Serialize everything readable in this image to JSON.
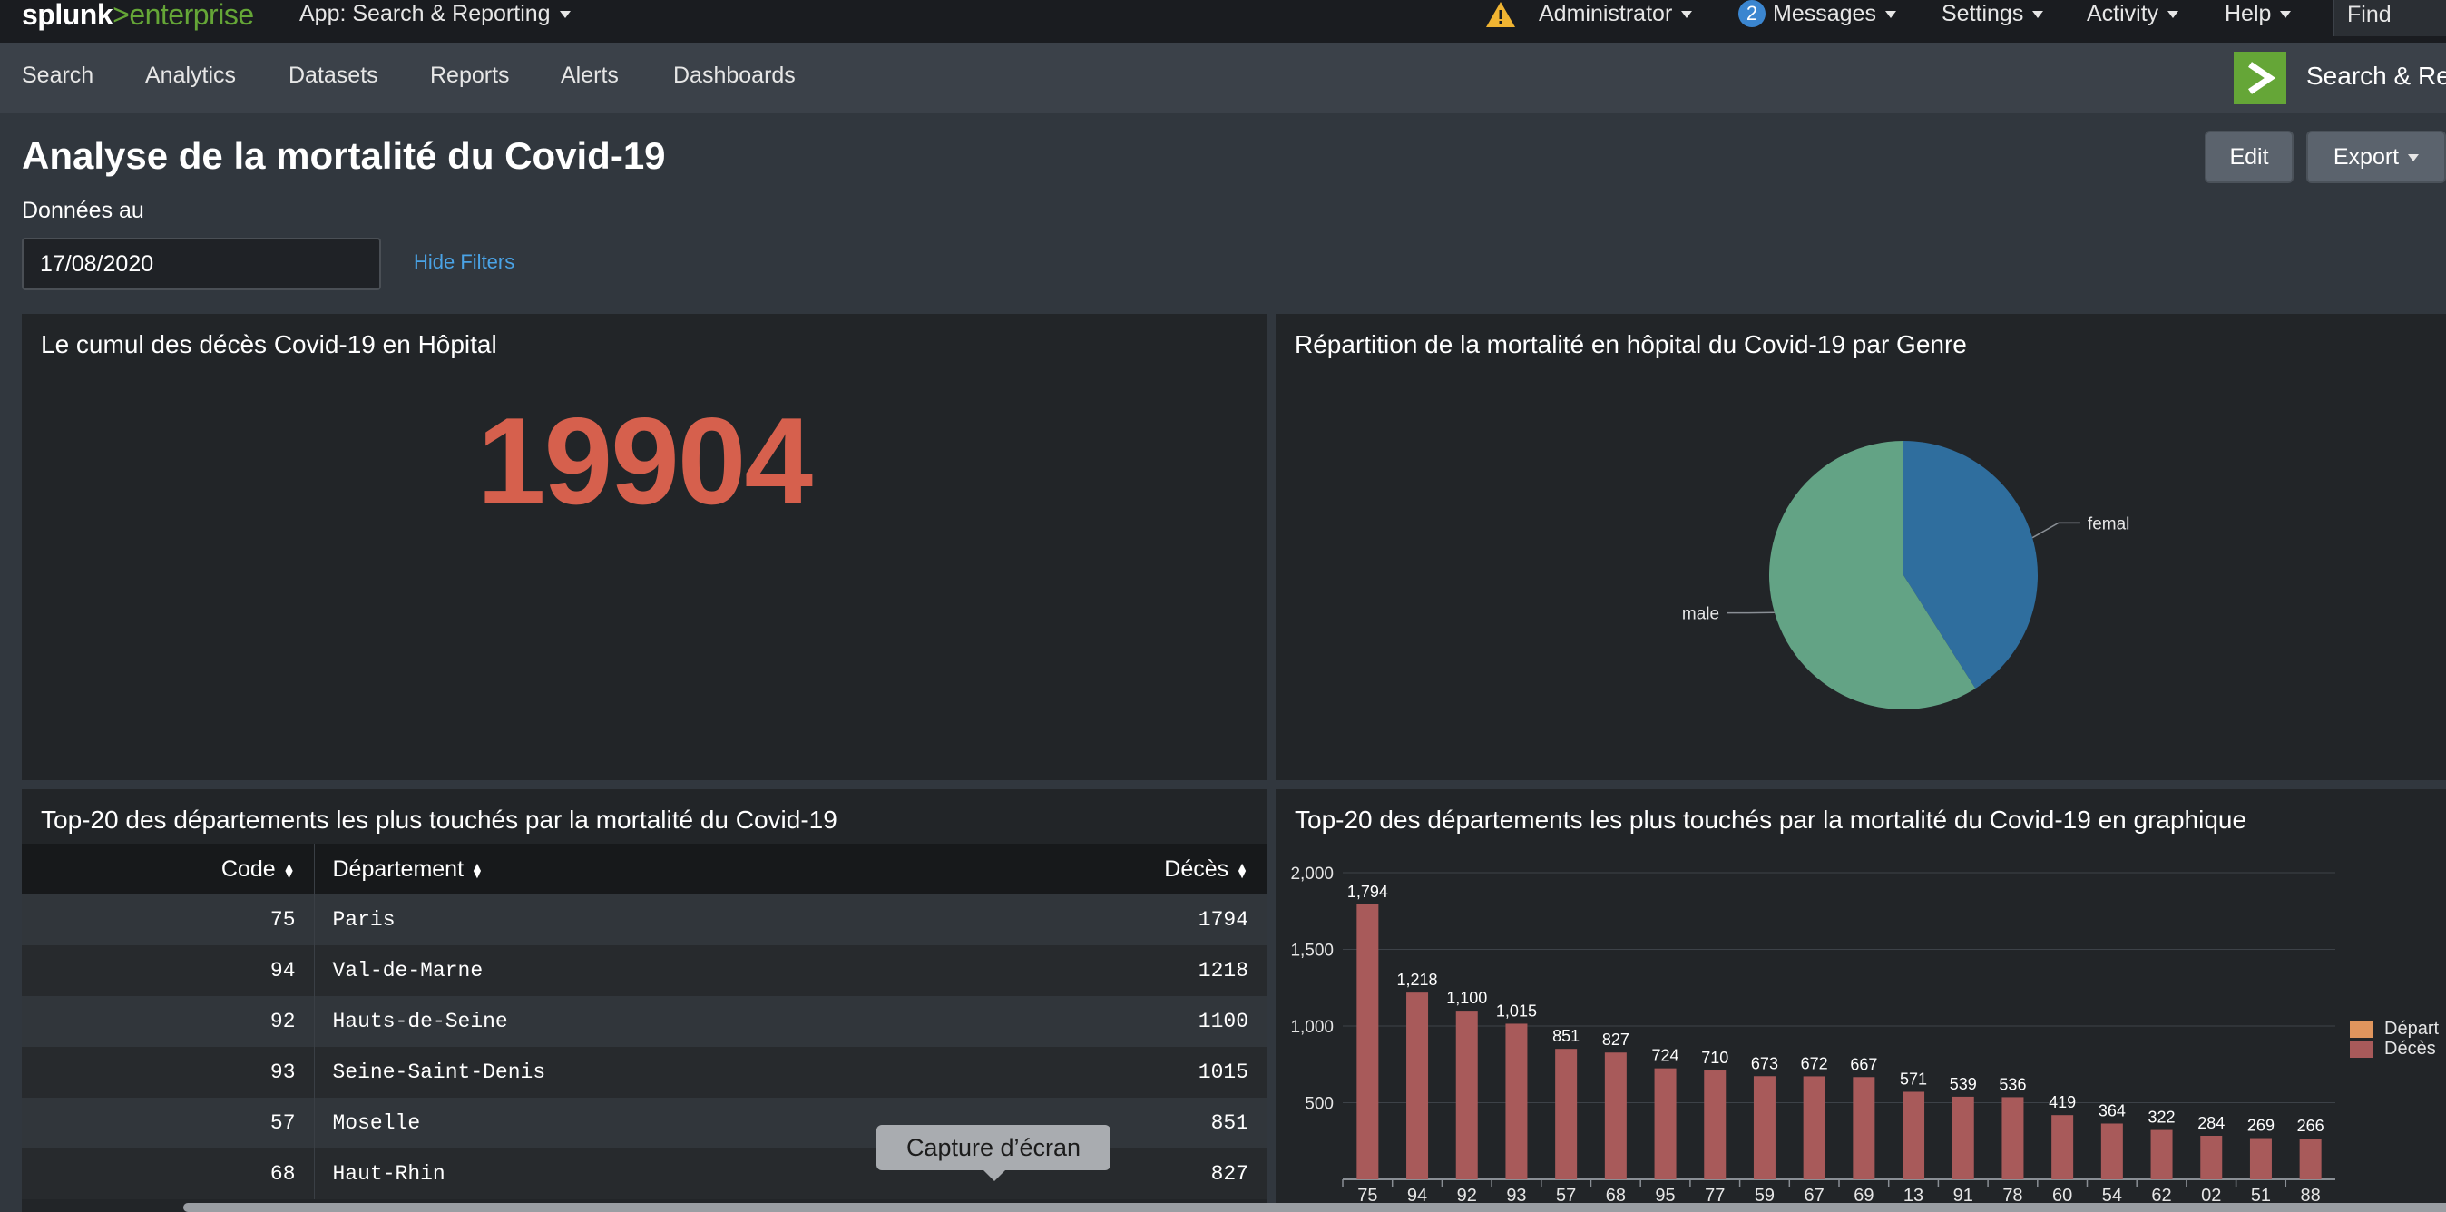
{
  "topbar": {
    "logo_main": "splunk",
    "logo_sep": ">",
    "logo_sub": "enterprise",
    "app_menu": "App: Search & Reporting",
    "user_menu": "Administrator",
    "messages_count": "2",
    "messages_label": "Messages",
    "settings": "Settings",
    "activity": "Activity",
    "help": "Help",
    "find": "Find"
  },
  "appbar": {
    "items": [
      "Search",
      "Analytics",
      "Datasets",
      "Reports",
      "Alerts",
      "Dashboards"
    ],
    "app_title": "Search & Re"
  },
  "dashboard": {
    "title": "Analyse de la mortalité du Covid-19",
    "edit": "Edit",
    "export": "Export",
    "filter_label": "Données au",
    "filter_value": "17/08/2020",
    "hide_filters": "Hide Filters"
  },
  "panels": {
    "single": {
      "title": "Le cumul des décès Covid-19 en Hôpital",
      "value": "19904"
    },
    "pie": {
      "title": "Répartition de la mortalité en hôpital du Covid-19 par Genre"
    },
    "table": {
      "title": "Top-20 des départements les plus touchés par la mortalité du Covid-19"
    },
    "bar": {
      "title": "Top-20 des départements les plus touchés par la mortalité du Covid-19 en graphique"
    }
  },
  "table": {
    "headers": [
      "Code",
      "Département",
      "Décès"
    ],
    "rows": [
      [
        "75",
        "Paris",
        "1794"
      ],
      [
        "94",
        "Val-de-Marne",
        "1218"
      ],
      [
        "92",
        "Hauts-de-Seine",
        "1100"
      ],
      [
        "93",
        "Seine-Saint-Denis",
        "1015"
      ],
      [
        "57",
        "Moselle",
        "851"
      ],
      [
        "68",
        "Haut-Rhin",
        "827"
      ]
    ]
  },
  "tooltip": "Capture d’écran",
  "colors": {
    "accent_green": "#65a637",
    "single_value": "#d6604d",
    "pie_male": "#63a385",
    "pie_femal": "#2f6e9e",
    "bar_deces": "#a85a5a",
    "legend_departement": "#e0955d",
    "link_blue": "#4aa3e6"
  },
  "chart_data": [
    {
      "type": "pie",
      "categories": [
        "femal",
        "male"
      ],
      "values": [
        41,
        59
      ]
    },
    {
      "type": "bar",
      "categories": [
        "75",
        "94",
        "92",
        "93",
        "57",
        "68",
        "95",
        "77",
        "59",
        "67",
        "69",
        "13",
        "91",
        "78",
        "60",
        "54",
        "62",
        "02",
        "51",
        "88"
      ],
      "series": [
        {
          "name": "Décès",
          "values": [
            1794,
            1218,
            1100,
            1015,
            851,
            827,
            724,
            710,
            673,
            672,
            667,
            571,
            539,
            536,
            419,
            364,
            322,
            284,
            269,
            266
          ]
        }
      ],
      "legend": [
        "Départ",
        "Décès"
      ],
      "y_ticks": [
        "2,000",
        "1,500",
        "1,000",
        "500"
      ],
      "ylim": [
        0,
        2000
      ],
      "legend_placement": "right",
      "grid": true
    }
  ]
}
